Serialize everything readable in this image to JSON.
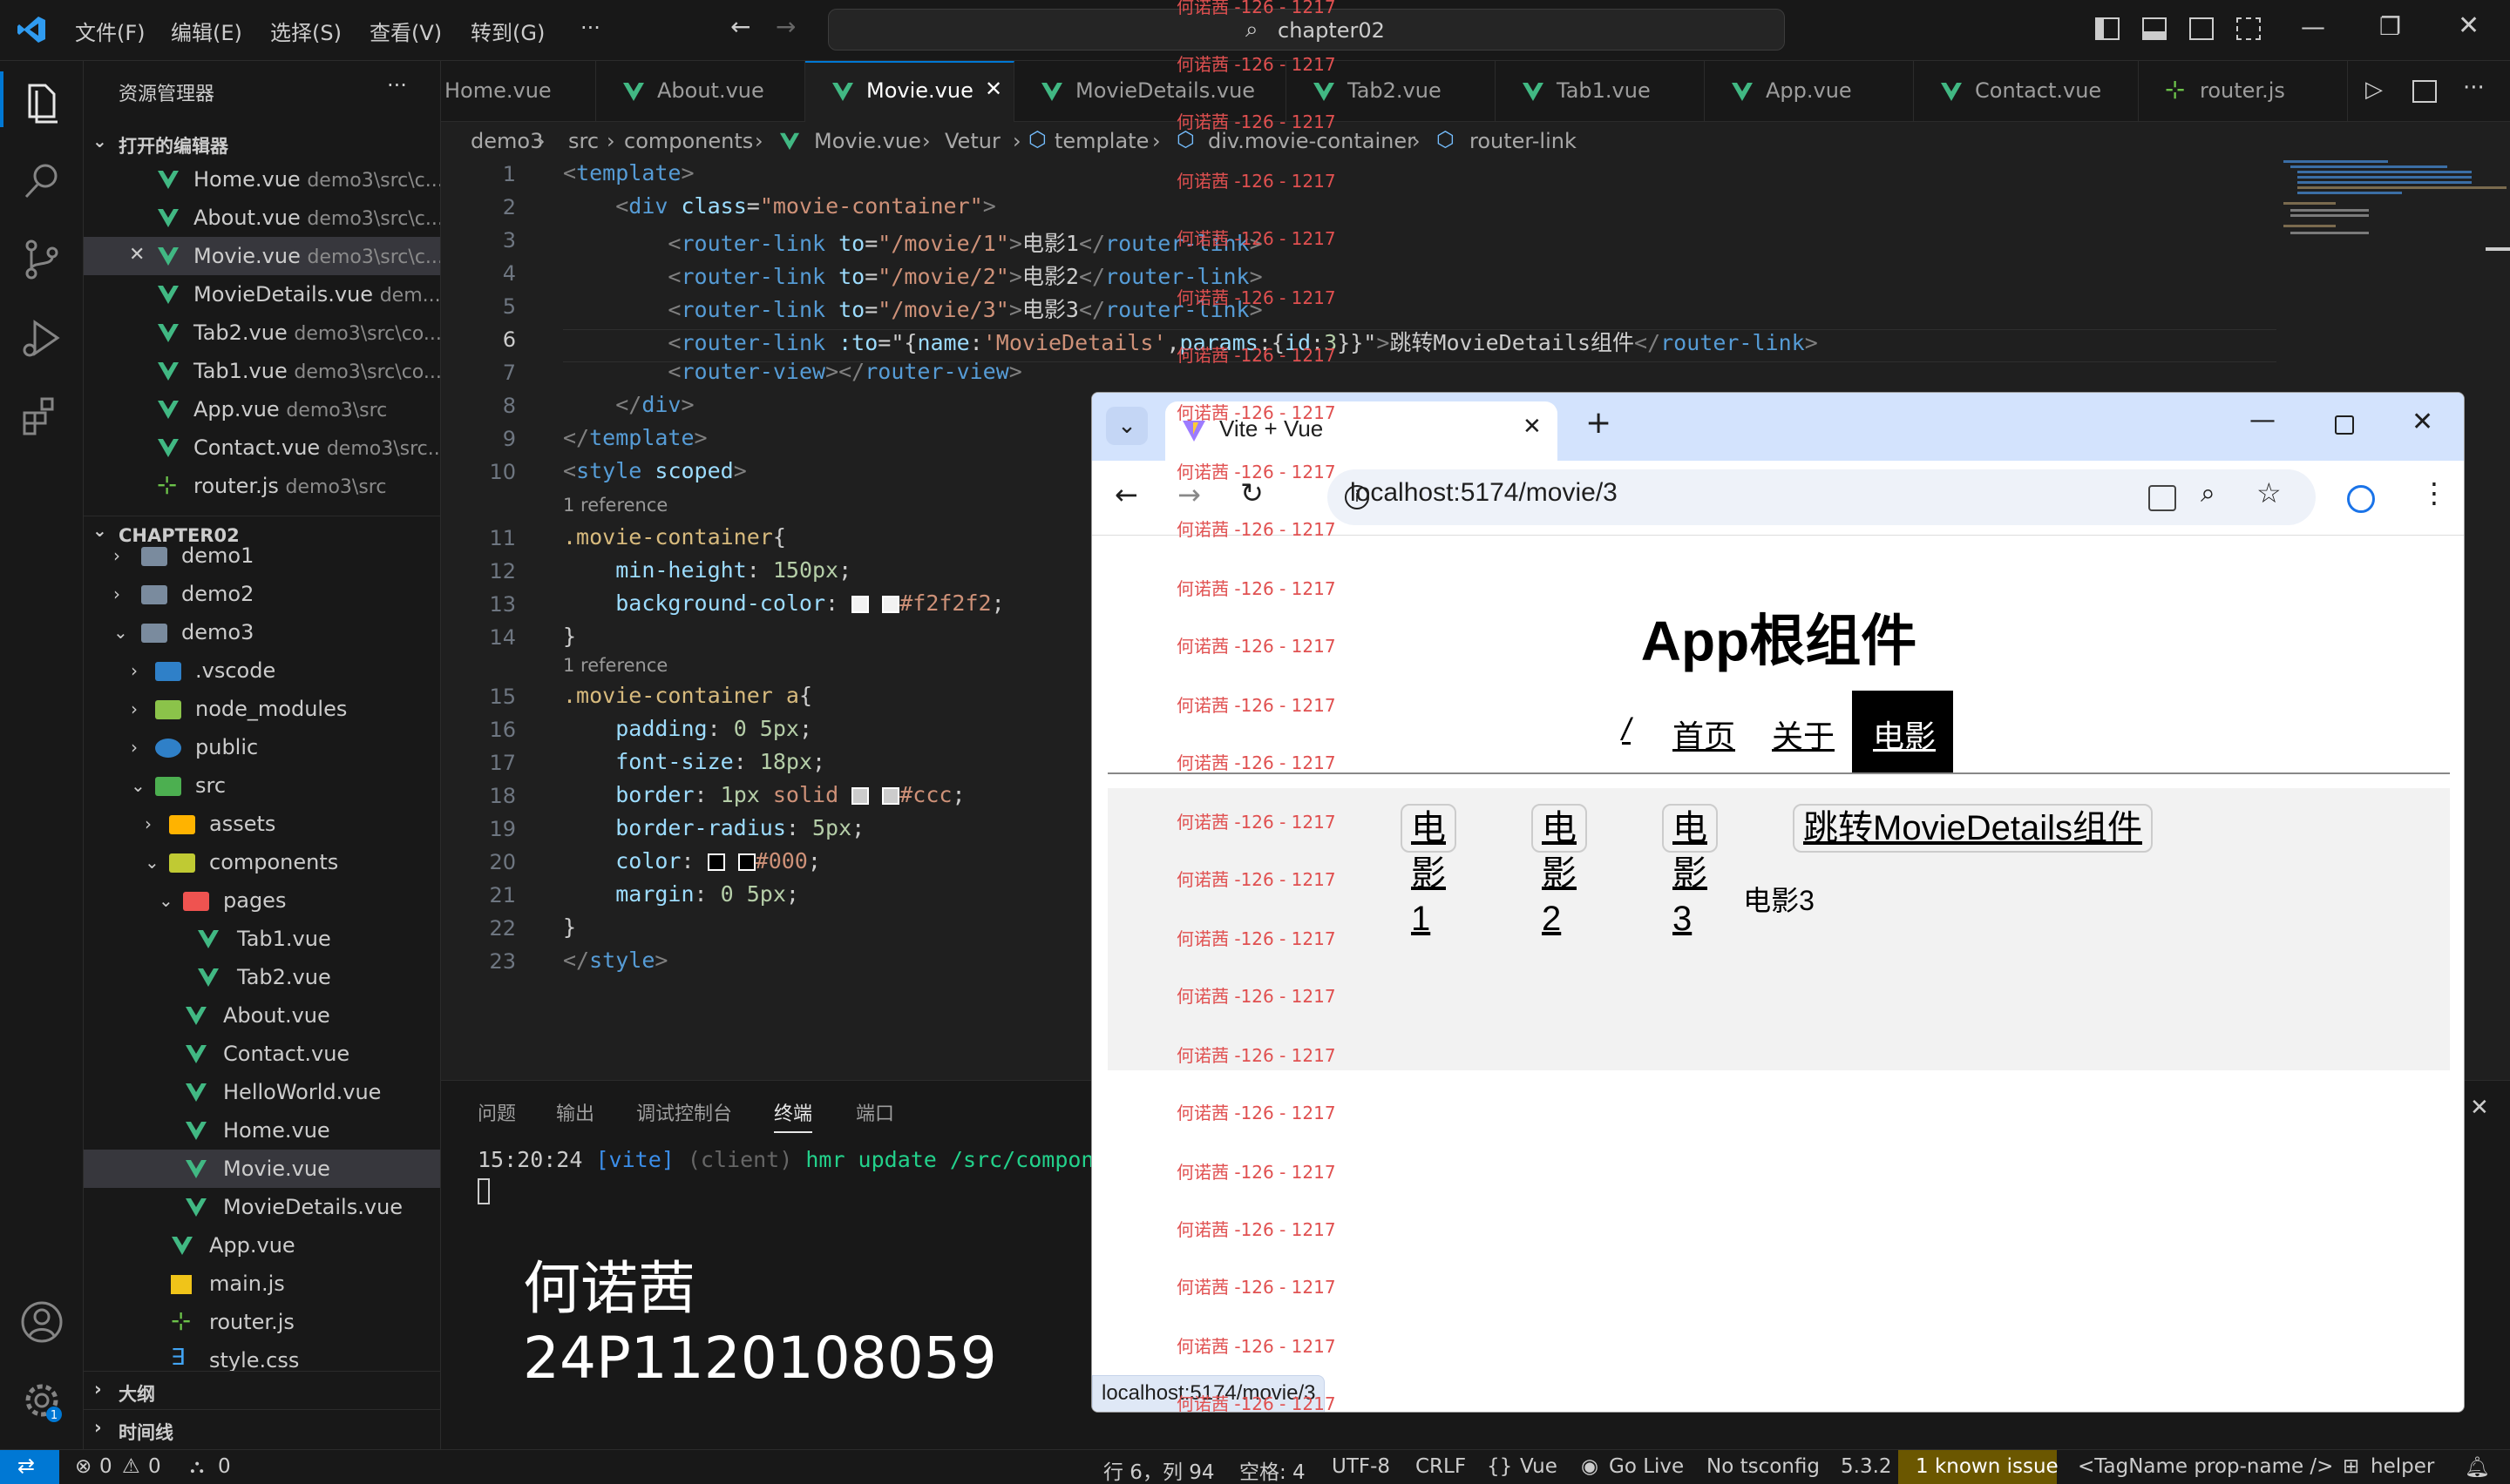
{
  "menu": [
    "文件(F)",
    "编辑(E)",
    "选择(S)",
    "查看(V)",
    "转到(G)",
    "···"
  ],
  "command_center": "chapter02",
  "sidebar": {
    "title": "资源管理器",
    "open_editors_header": "打开的编辑器",
    "open_editors": [
      {
        "name": "Home.vue",
        "path": "demo3\\src\\c..."
      },
      {
        "name": "About.vue",
        "path": "demo3\\src\\c..."
      },
      {
        "name": "Movie.vue",
        "path": "demo3\\src\\c..."
      },
      {
        "name": "MovieDetails.vue",
        "path": "dem..."
      },
      {
        "name": "Tab2.vue",
        "path": "demo3\\src\\co..."
      },
      {
        "name": "Tab1.vue",
        "path": "demo3\\src\\co..."
      },
      {
        "name": "App.vue",
        "path": "demo3\\src"
      },
      {
        "name": "Contact.vue",
        "path": "demo3\\src..."
      },
      {
        "name": "router.js",
        "path": "demo3\\src"
      }
    ],
    "workspace_header": "CHAPTER02",
    "tree": [
      "demo1",
      "demo2",
      "demo3",
      ".vscode",
      "node_modules",
      "public",
      "src",
      "assets",
      "components",
      "pages",
      "Tab1.vue",
      "Tab2.vue",
      "About.vue",
      "Contact.vue",
      "HelloWorld.vue",
      "Home.vue",
      "Movie.vue",
      "MovieDetails.vue",
      "App.vue",
      "main.js",
      "router.js",
      "style.css"
    ],
    "outline": "大纲",
    "timeline": "时间线"
  },
  "tabs": [
    "Home.vue",
    "About.vue",
    "Movie.vue",
    "MovieDetails.vue",
    "Tab2.vue",
    "Tab1.vue",
    "App.vue",
    "Contact.vue",
    "router.js"
  ],
  "breadcrumb": [
    "demo3",
    "src",
    "components",
    "Movie.vue",
    "Vetur",
    "template",
    "div.movie-container",
    "router-link"
  ],
  "line_numbers": [
    "1",
    "2",
    "3",
    "4",
    "5",
    "6",
    "7",
    "8",
    "9",
    "10",
    "11",
    "12",
    "13",
    "14",
    "15",
    "16",
    "17",
    "18",
    "19",
    "20",
    "21",
    "22",
    "23"
  ],
  "references": "1 reference",
  "panel": {
    "tabs": [
      "问题",
      "输出",
      "调试控制台",
      "终端",
      "端口"
    ],
    "term_time": "15:20:24",
    "term_vite": "[vite]",
    "term_client": "(client)",
    "term_msg": "hmr update /src/compon"
  },
  "overlay": {
    "name": "何诺茜",
    "id": "24P1120108059"
  },
  "watermark": "何诺茜 -126 - 1217",
  "browser": {
    "tab_title": "Vite + Vue",
    "url": "localhost:5174/movie/3",
    "status_url": "localhost:5174/movie/3",
    "page_title": "App根组件",
    "nav": [
      "/",
      "首页",
      "关于",
      "电影"
    ],
    "movie_links": [
      "电影1",
      "电影2",
      "电影3",
      "跳转MovieDetails组件"
    ],
    "content": "电影3"
  },
  "statusbar": {
    "errors": "0",
    "warnings": "0",
    "ports": "0",
    "position": "行 6，列 94",
    "spaces": "空格: 4",
    "encoding": "UTF-8",
    "eol": "CRLF",
    "language": "Vue",
    "golive": "Go Live",
    "tsconfig": "No tsconfig",
    "version": "5.3.2",
    "issue": "1 known issue",
    "tagname": "<TagName prop-name />",
    "helper": "helper"
  }
}
